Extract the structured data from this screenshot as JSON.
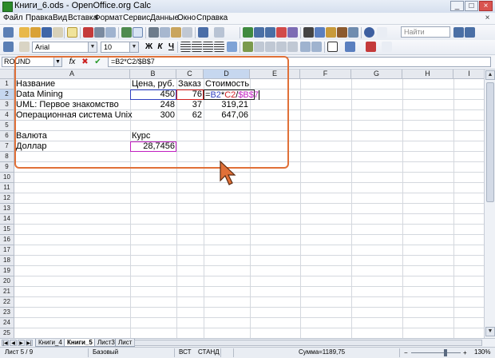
{
  "window": {
    "title": "Книги_6.ods - OpenOffice.org Calc",
    "buttons": [
      "_",
      "□",
      "×"
    ]
  },
  "menu": {
    "items": [
      "Файл",
      "Правка",
      "Вид",
      "Вставка",
      "Формат",
      "Сервис",
      "Данные",
      "Окно",
      "Справка"
    ],
    "close_glyph": "×"
  },
  "toolbar": {
    "find_placeholder": "Найти",
    "font_name": "Arial",
    "font_size": "10",
    "bold": "Ж",
    "italic": "К",
    "underline": "Ч"
  },
  "formula_bar": {
    "name_box": "ROUND",
    "function_glyph": "fx",
    "cancel_glyph": "✖",
    "accept_glyph": "✔",
    "formula": "=B2*C2/$B$7"
  },
  "grid": {
    "columns": [
      "A",
      "B",
      "C",
      "D",
      "E",
      "F",
      "G",
      "H",
      "I"
    ],
    "rows": [
      "1",
      "2",
      "3",
      "4",
      "5",
      "6",
      "7",
      "8",
      "9",
      "10",
      "11",
      "12",
      "13",
      "14",
      "15",
      "16",
      "17",
      "18",
      "19",
      "20",
      "21",
      "22",
      "23",
      "24",
      "25"
    ],
    "selected_column": "D",
    "selected_row": "2",
    "cells": {
      "A1": "Название",
      "B1": "Цена, руб.",
      "C1": "Заказ",
      "D1": "Стоимость",
      "A2": "Data Mining",
      "B2": "450",
      "C2": "76",
      "A3": "UML: Первое знакомство",
      "B3": "248",
      "C3": "37",
      "D3": "319,21",
      "A4": "Операционная система Unix",
      "B4": "300",
      "C4": "62",
      "D4": "647,06",
      "A6": "Валюта",
      "B6": "Курс",
      "A7": "Доллар",
      "B7": "28,7456"
    },
    "edit_formula_parts": [
      "=",
      "B2",
      "*",
      "C2",
      "/",
      "$B$7"
    ],
    "ref_colors": {
      "b2": "#3040c0",
      "c2": "#d02020",
      "b7": "#c020c0"
    }
  },
  "sheets": {
    "tabs": [
      "Книги_4",
      "Книги_5",
      "Лист3",
      "Лист"
    ],
    "active": "Книги_5"
  },
  "status": {
    "sheet": "Лист 5 / 9",
    "style": "Базовый",
    "mode": "ВСТ",
    "selection": "СТАНД",
    "sum": "Сумма=1189,75",
    "zoom": "130%"
  },
  "colors": {
    "annotation": "#e07038",
    "selected_header": "#c6d7ef"
  }
}
